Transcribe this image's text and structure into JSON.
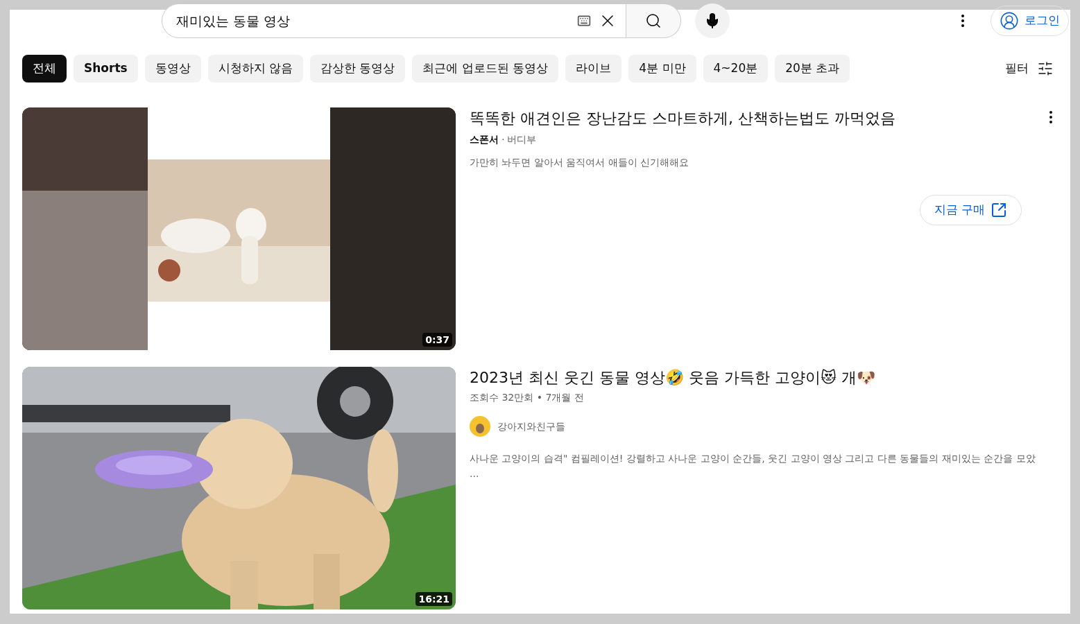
{
  "search": {
    "value": "재미있는 동물 영상"
  },
  "header": {
    "login": "로그인"
  },
  "chips": [
    {
      "label": "전체",
      "selected": true
    },
    {
      "label": "Shorts",
      "selected": false
    },
    {
      "label": "동영상",
      "selected": false
    },
    {
      "label": "시청하지 않음",
      "selected": false
    },
    {
      "label": "감상한 동영상",
      "selected": false
    },
    {
      "label": "최근에 업로드된 동영상",
      "selected": false
    },
    {
      "label": "라이브",
      "selected": false
    },
    {
      "label": "4분 미만",
      "selected": false
    },
    {
      "label": "4~20분",
      "selected": false
    },
    {
      "label": "20분 초과",
      "selected": false
    }
  ],
  "filter": "필터",
  "results": [
    {
      "kind": "ad",
      "duration": "0:37",
      "title": "똑똑한 애견인은 장난감도 스마트하게, 산책하는법도 까먹었음",
      "sponsor": "스폰서",
      "separator": "·",
      "advertiser": "버디부",
      "description": "가만히 놔두면 알아서 움직여서 애들이 신기해해요",
      "cta": "지금 구매"
    },
    {
      "kind": "video",
      "duration": "16:21",
      "title": "2023년 최신 웃긴 동물 영상🤣 웃음 가득한 고양이😻 개🐶",
      "meta": "조회수 32만회 • 7개월 전",
      "channel": "강아지와친구들",
      "description": "사나운 고양이의 습격\" 컴필레이션! 강렬하고 사나운 고양이 순간들, 웃긴 고양이 영상 그리고 다른 동물들의 재미있는 순간을 모았 ..."
    }
  ]
}
